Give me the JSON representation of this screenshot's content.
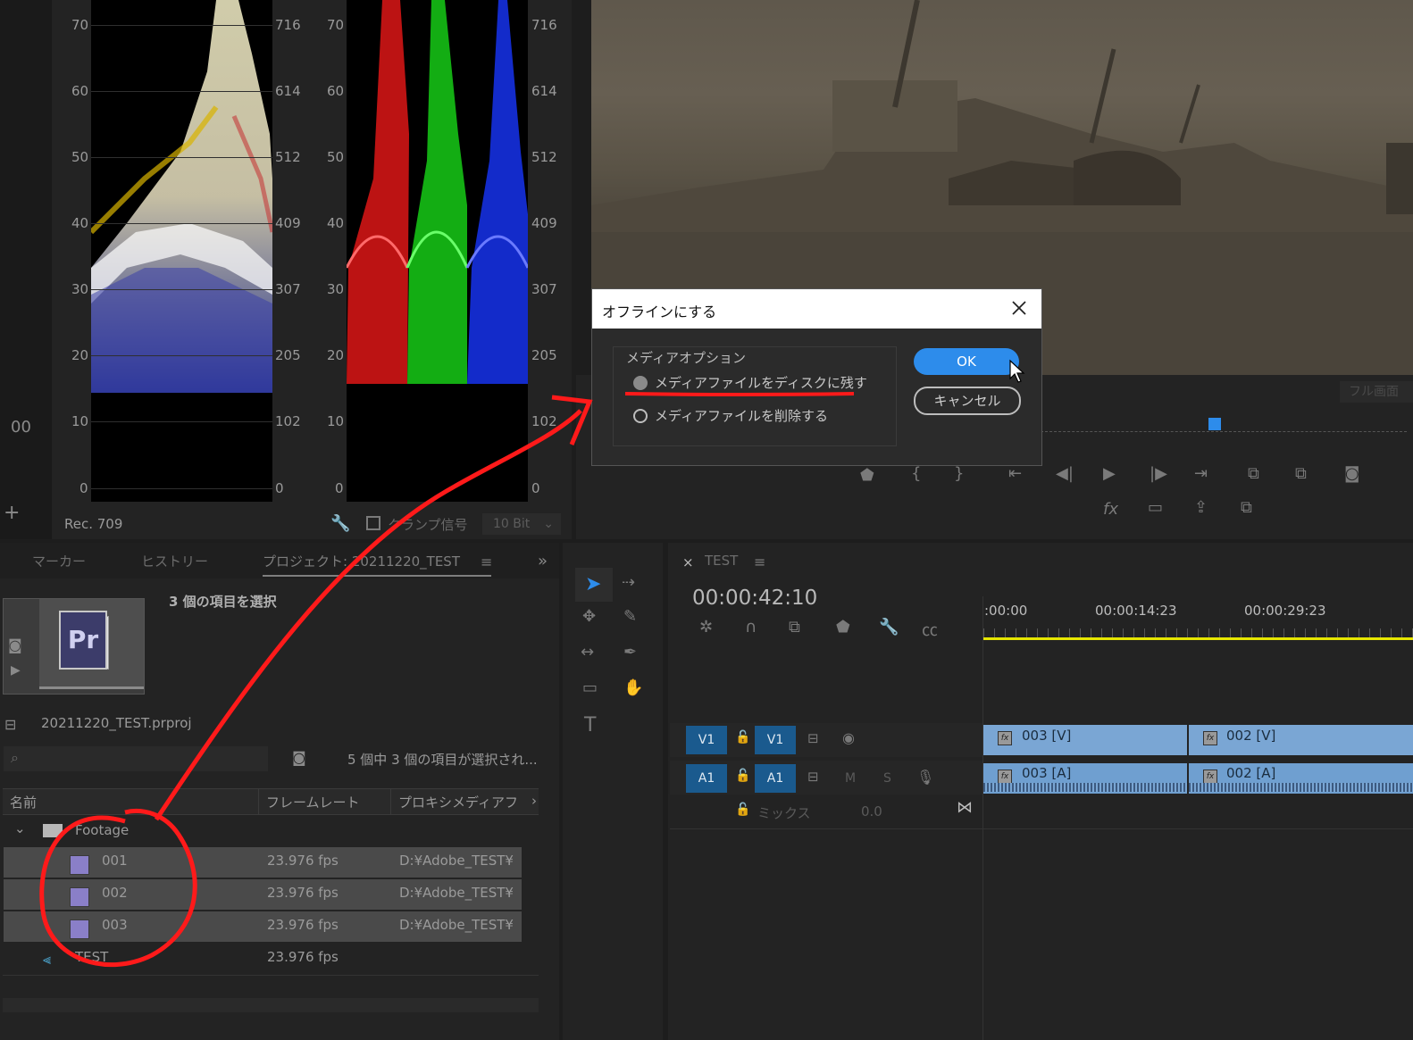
{
  "scopes": {
    "left_ire_ticks": [
      "70",
      "60",
      "50",
      "40",
      "30",
      "20",
      "10",
      "0"
    ],
    "left_code_ticks": [
      "716",
      "614",
      "512",
      "409",
      "307",
      "205",
      "102",
      "0"
    ],
    "right_ire_ticks": [
      "70",
      "60",
      "50",
      "40",
      "30",
      "20",
      "10",
      "0"
    ],
    "right_code_ticks": [
      "716",
      "614",
      "512",
      "409",
      "307",
      "205",
      "102",
      "0"
    ],
    "standard": "Rec. 709",
    "clamp_label": "クランプ信号",
    "bit_depth": "10 Bit",
    "side_readout": "00"
  },
  "dialog": {
    "title": "オフラインにする",
    "group_label": "メディアオプション",
    "option_keep": "メディアファイルをディスクに残す",
    "option_delete": "メディアファイルを削除する",
    "ok_label": "OK",
    "cancel_label": "キャンセル"
  },
  "program": {
    "fit_label": "フル画面"
  },
  "project": {
    "tabs": [
      "マーカー",
      "ヒストリー",
      "プロジェクト: 20211220_TEST"
    ],
    "selection_title": "3 個の項目を選択",
    "project_file": "20211220_TEST.prproj",
    "selection_status": "5 個中 3 個の項目が選択され...",
    "columns": [
      "名前",
      "フレームレート",
      "プロキシメディアフ"
    ],
    "folder": "Footage",
    "items": [
      {
        "name": "001",
        "fps": "23.976 fps",
        "path": "D:¥Adobe_TEST¥"
      },
      {
        "name": "002",
        "fps": "23.976 fps",
        "path": "D:¥Adobe_TEST¥"
      },
      {
        "name": "003",
        "fps": "23.976 fps",
        "path": "D:¥Adobe_TEST¥"
      }
    ],
    "sequence": {
      "name": "TEST",
      "fps": "23.976 fps"
    }
  },
  "timeline": {
    "tab": "TEST",
    "timecode": "00:00:42:10",
    "ruler": [
      ":00:00",
      "00:00:14:23",
      "00:00:29:23"
    ],
    "v1_src": "V1",
    "v1": "V1",
    "a1_src": "A1",
    "a1": "A1",
    "mute": "M",
    "solo": "S",
    "mix_label": "ミックス",
    "mix_value": "0.0",
    "clips_video": [
      "003 [V]",
      "002 [V]"
    ],
    "clips_audio": [
      "003 [A]",
      "002 [A]"
    ]
  },
  "colors": {
    "accent": "#2d8ceb",
    "annotation": "#ff1a1a",
    "track_blue": "#1a5a8e",
    "clip_blue": "#7aa6d4",
    "playhead_line": "#e6e600"
  }
}
